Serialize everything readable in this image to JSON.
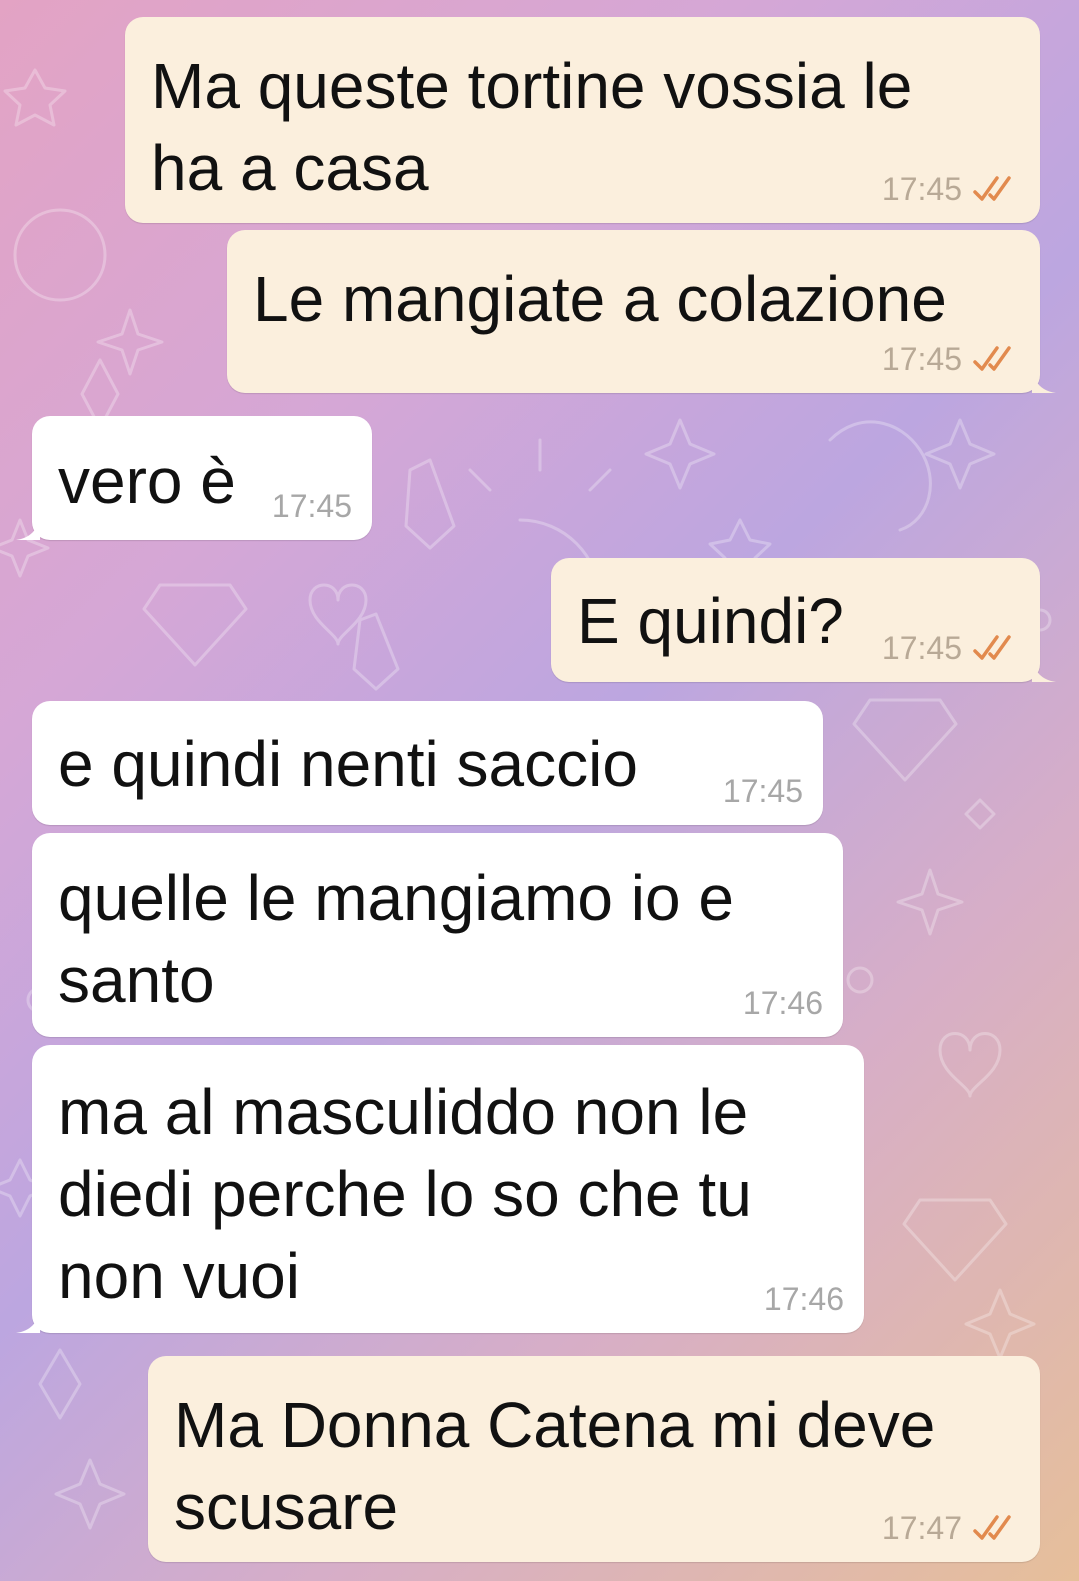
{
  "theme": {
    "outgoing_bubble": "#fbefdd",
    "incoming_bubble": "#ffffff",
    "check_color": "#e28a4e"
  },
  "messages": [
    {
      "text": "Ma queste tortine vossia le\nha a casa",
      "time": "17:45",
      "direction": "outgoing",
      "status_icon": "double-check-icon"
    },
    {
      "text": "Le mangiate a colazione",
      "time": "17:45",
      "direction": "outgoing",
      "status_icon": "double-check-icon"
    },
    {
      "text": "vero è",
      "time": "17:45",
      "direction": "incoming"
    },
    {
      "text": "E quindi?",
      "time": "17:45",
      "direction": "outgoing",
      "status_icon": "double-check-icon"
    },
    {
      "text": "e quindi nenti saccio",
      "time": "17:45",
      "direction": "incoming"
    },
    {
      "text": "quelle le mangiamo io e\nsanto",
      "time": "17:46",
      "direction": "incoming"
    },
    {
      "text": "ma al masculiddo non le\ndiedi perche lo so che tu\nnon vuoi",
      "time": "17:46",
      "direction": "incoming"
    },
    {
      "text": "Ma Donna Catena mi deve\nscusare",
      "time": "17:47",
      "direction": "outgoing",
      "status_icon": "double-check-icon"
    }
  ]
}
